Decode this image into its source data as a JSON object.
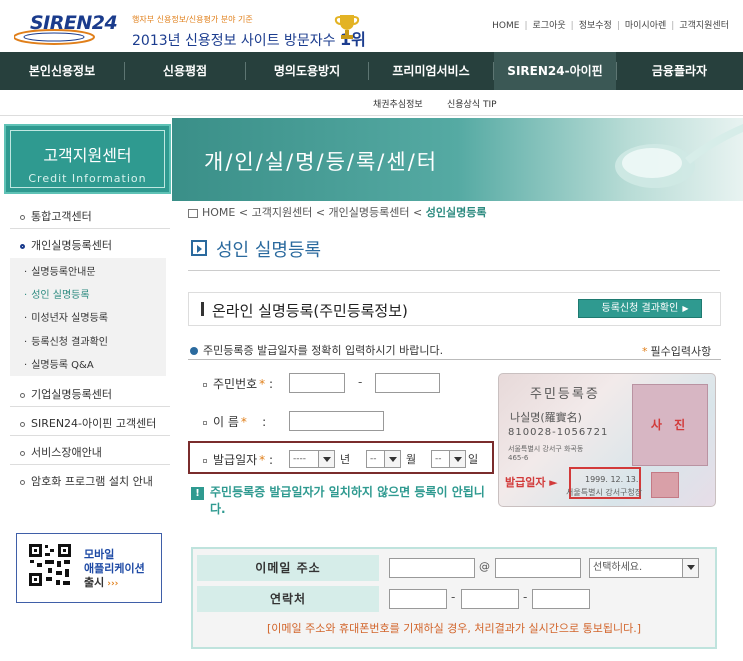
{
  "header": {
    "logo": "SIREN24",
    "slogan_small": "행자부 신용정보/신용평가 분야 기준",
    "slogan_main": "2013년 신용정보 사이트 방문자수",
    "slogan_rank": "1위",
    "top_links": [
      "HOME",
      "로그아웃",
      "정보수정",
      "마이시아렌",
      "고객지원센터"
    ]
  },
  "gnb": {
    "items": [
      "본인신용정보",
      "신용평점",
      "명의도용방지",
      "프리미엄서비스",
      "SIREN24-아이핀",
      "금융플라자"
    ],
    "active_index": 4
  },
  "subnav": {
    "items": [
      "채권추심정보",
      "신용상식 TIP"
    ]
  },
  "sidebar": {
    "title": "고객지원센터",
    "subtitle": "Credit Information",
    "items": [
      "통합고객센터",
      "개인실명등록센터",
      "기업실명등록센터",
      "SIREN24-아이핀 고객센터",
      "서비스장애안내",
      "암호화 프로그램 설치 안내"
    ],
    "subitems": [
      "실명등록안내문",
      "성인 실명등록",
      "미성년자 실명등록",
      "등록신청 결과확인",
      "실명등록 Q&A"
    ],
    "mobile": {
      "line1": "모바일",
      "line2": "애플리케이션",
      "line3": "출시",
      "arrow": "›››"
    }
  },
  "banner": {
    "title": "개/인/실/명/등/록/센/터"
  },
  "breadcrumb": {
    "items": [
      "HOME",
      "고객지원센터",
      "개인실명등록센터"
    ],
    "current": "성인실명등록",
    "sep": "<"
  },
  "page": {
    "title": "성인 실명등록"
  },
  "section": {
    "title": "온라인 실명등록(주민등록정보)",
    "result_button": "등록신청 결과확인",
    "notice": "주민등록증 발급일자를 정확히 입력하시기 바랍니다.",
    "required_note": "필수입력사항",
    "required_star": "*"
  },
  "form": {
    "rrn_label": "주민번호",
    "name_label": "이 름",
    "issue_label": "발급일자",
    "req_mark": "*",
    "colon": ":",
    "dash": "-",
    "year_select": "----",
    "month_select": "--",
    "day_select": "--",
    "year_unit": "년",
    "month_unit": "월",
    "day_unit": "일",
    "rrn1": "",
    "rrn2": "",
    "name": ""
  },
  "warning": {
    "icon": "!",
    "text": "주민등록증 발급일자가 일치하지 않으면 등록이 안됩니다."
  },
  "idcard": {
    "title": "주민등록증",
    "name": "나실명(羅實名)",
    "number": "810028-1056721",
    "addr1": "서울특별시 강서구 화곡동",
    "addr2": "465-6",
    "photo_label": "사 진",
    "issue_label": "발급일자 ►",
    "issue_date": "1999. 12. 13.",
    "office": "서울특별시 강서구청장"
  },
  "contact": {
    "email_label": "이메일 주소",
    "phone_label": "연락처",
    "at": "@",
    "domain_select": "선택하세요.",
    "dash": "-",
    "note": "[이메일 주소와 휴대폰번호를 기재하실 경우, 처리결과가 실시간으로 통보됩니다.]"
  }
}
